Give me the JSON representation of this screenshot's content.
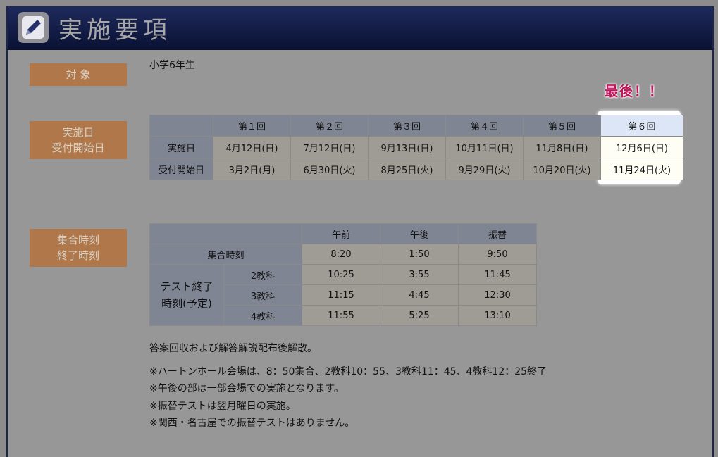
{
  "header": {
    "title": "実施要項",
    "icon": "pencil-icon"
  },
  "target": {
    "label": "対 象",
    "value": "小学6年生"
  },
  "dates": {
    "label_line1": "実施日",
    "label_line2": "受付開始日",
    "last_note": "最後！！",
    "columns": [
      "第１回",
      "第２回",
      "第３回",
      "第４回",
      "第５回",
      "第６回"
    ],
    "rows": [
      {
        "head": "実施日",
        "cells": [
          "4月12日(日)",
          "7月12日(日)",
          "9月13日(日)",
          "10月11日(日)",
          "11月8日(日)",
          "12月6日(日)"
        ]
      },
      {
        "head": "受付開始日",
        "cells": [
          "3月2日(月)",
          "6月30日(火)",
          "8月25日(火)",
          "9月29日(火)",
          "10月20日(火)",
          "11月24日(火)"
        ]
      }
    ]
  },
  "times": {
    "label_line1": "集合時刻",
    "label_line2": "終了時刻",
    "columns": [
      "午前",
      "午後",
      "振替"
    ],
    "gather": {
      "head": "集合時刻",
      "cells": [
        "8:20",
        "1:50",
        "9:50"
      ]
    },
    "end_group": "テスト終了\n時刻(予定)",
    "end_rows": [
      {
        "head": "2教科",
        "cells": [
          "10:25",
          "3:55",
          "11:45"
        ]
      },
      {
        "head": "3教科",
        "cells": [
          "11:15",
          "4:45",
          "12:30"
        ]
      },
      {
        "head": "4教科",
        "cells": [
          "11:55",
          "5:25",
          "13:10"
        ]
      }
    ]
  },
  "notes": {
    "dismiss": "答案回収および解答解説配布後解散。",
    "items": [
      "※ハートンホール会場は、8：50集合、2教科10：55、3教科11：45、4教科12：25終了",
      "※午後の部は一部会場での実施となります。",
      "※振替テストは翌月曜日の実施。",
      "※関西・名古屋での振替テストはありません。"
    ]
  }
}
